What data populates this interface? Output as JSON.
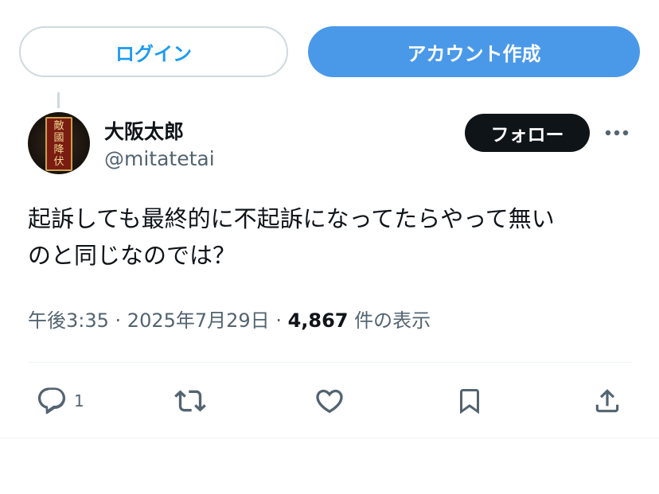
{
  "auth": {
    "login_label": "ログイン",
    "signup_label": "アカウント作成"
  },
  "tweet": {
    "avatar_text": [
      "敵",
      "國",
      "降",
      "伏"
    ],
    "display_name": "大阪太郎",
    "handle": "@mitatetai",
    "follow_label": "フォロー",
    "text_line1": "起訴しても最終的に不起訴になってたらやって無い",
    "text_line2": "のと同じなのでは？",
    "time": "午後3:35",
    "separator": " · ",
    "date": "2025年7月29日",
    "views_count": "4,867",
    "views_label": " 件の表示"
  },
  "actions": {
    "reply_count": "1",
    "icons": [
      "reply-icon",
      "retweet-icon",
      "like-icon",
      "bookmark-icon",
      "share-icon"
    ]
  },
  "colors": {
    "accent": "#1d9bf0",
    "signup_bg": "#4a99e9",
    "follow_bg": "#0f1419",
    "secondary_text": "#536471"
  }
}
